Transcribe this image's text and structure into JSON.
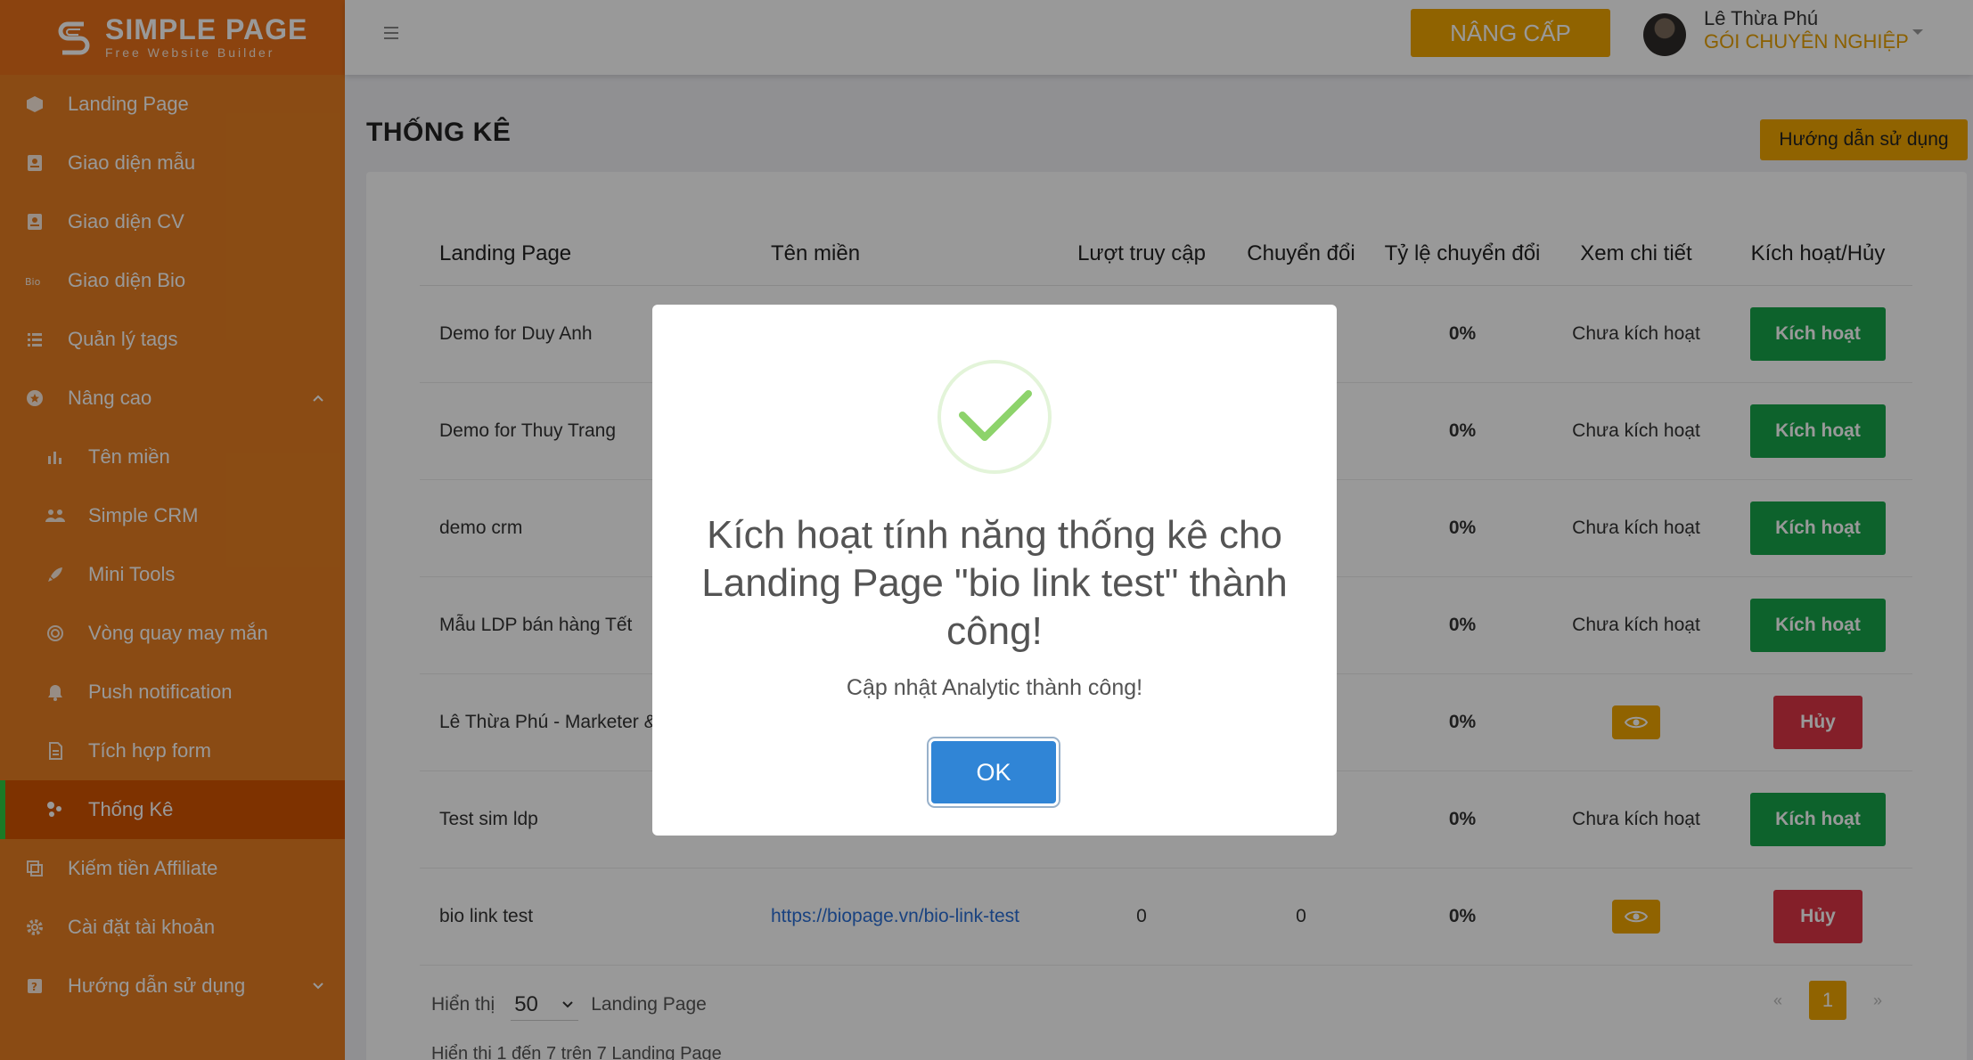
{
  "brand": {
    "name": "SIMPLE PAGE",
    "tagline": "Free Website Builder"
  },
  "sidebar": {
    "items": [
      {
        "label": "Landing Page",
        "icon": "cube-icon"
      },
      {
        "label": "Giao diện mẫu",
        "icon": "template-icon"
      },
      {
        "label": "Giao diện CV",
        "icon": "cv-icon"
      },
      {
        "label": "Giao diện Bio",
        "icon": "bio-icon"
      },
      {
        "label": "Quản lý tags",
        "icon": "tags-icon"
      },
      {
        "label": "Nâng cao",
        "icon": "advanced-icon",
        "expanded": true
      },
      {
        "label": "Tên miền",
        "icon": "domain-icon"
      },
      {
        "label": "Simple CRM",
        "icon": "crm-icon"
      },
      {
        "label": "Mini Tools",
        "icon": "tools-icon"
      },
      {
        "label": "Vòng quay may mắn",
        "icon": "wheel-icon"
      },
      {
        "label": "Push notification",
        "icon": "bell-icon"
      },
      {
        "label": "Tích hợp form",
        "icon": "form-icon"
      },
      {
        "label": "Thống Kê",
        "icon": "stats-icon",
        "active": true
      },
      {
        "label": "Kiếm tiền Affiliate",
        "icon": "affiliate-icon"
      },
      {
        "label": "Cài đặt tài khoản",
        "icon": "settings-icon"
      },
      {
        "label": "Hướng dẫn sử dụng",
        "icon": "help-icon"
      }
    ]
  },
  "topbar": {
    "upgrade_label": "NÂNG CẤP",
    "user_name": "Lê Thừa Phú",
    "user_plan": "GÓI CHUYÊN NGHIỆP"
  },
  "page": {
    "title": "THỐNG KÊ",
    "guide_label": "Hướng dẫn sử dụng"
  },
  "table": {
    "headers": [
      "Landing Page",
      "Tên miền",
      "Lượt truy cập",
      "Chuyển đổi",
      "Tỷ lệ chuyển đổi",
      "Xem chi tiết",
      "Kích hoạt/Hủy"
    ],
    "rows": [
      {
        "name": "Demo for Duy Anh",
        "domain": "",
        "visits": "",
        "conversions": "",
        "rate": "0%",
        "detail": "Chưa kích hoạt",
        "action": "Kích hoạt"
      },
      {
        "name": "Demo for Thuy Trang",
        "domain": "",
        "visits": "",
        "conversions": "",
        "rate": "0%",
        "detail": "Chưa kích hoạt",
        "action": "Kích hoạt"
      },
      {
        "name": "demo crm",
        "domain": "",
        "visits": "",
        "conversions": "",
        "rate": "0%",
        "detail": "Chưa kích hoạt",
        "action": "Kích hoạt"
      },
      {
        "name": "Mẫu LDP bán hàng Tết",
        "domain": "",
        "visits": "",
        "conversions": "",
        "rate": "0%",
        "detail": "Chưa kích hoạt",
        "action": "Kích hoạt"
      },
      {
        "name": "Lê Thừa Phú - Marketer &",
        "domain": "",
        "visits": "",
        "conversions": "",
        "rate": "0%",
        "detail": "eye-icon",
        "action": "Hủy"
      },
      {
        "name": "Test sim ldp",
        "domain": "",
        "visits": "",
        "conversions": "",
        "rate": "0%",
        "detail": "Chưa kích hoạt",
        "action": "Kích hoạt"
      },
      {
        "name": "bio link test",
        "domain": "https://biopage.vn/bio-link-test",
        "visits": "0",
        "conversions": "0",
        "rate": "0%",
        "detail": "eye-icon",
        "action": "Hủy"
      }
    ]
  },
  "footer": {
    "show_label": "Hiển thị",
    "page_size": "50",
    "unit_label": "Landing Page",
    "info": "Hiển thị 1 đến 7 trên 7 Landing Page",
    "prev": "«",
    "current_page": "1",
    "next": "»"
  },
  "modal": {
    "title": "Kích hoạt tính năng thống kê cho Landing Page \"bio link test\" thành công!",
    "text": "Cập nhật Analytic thành công!",
    "ok_label": "OK"
  },
  "colors": {
    "sidebar": "#e67e22",
    "accent": "#f0a500",
    "activate": "#16a34a",
    "cancel": "#dc3545",
    "ok": "#3085d6",
    "success_check": "#8dd36b"
  }
}
